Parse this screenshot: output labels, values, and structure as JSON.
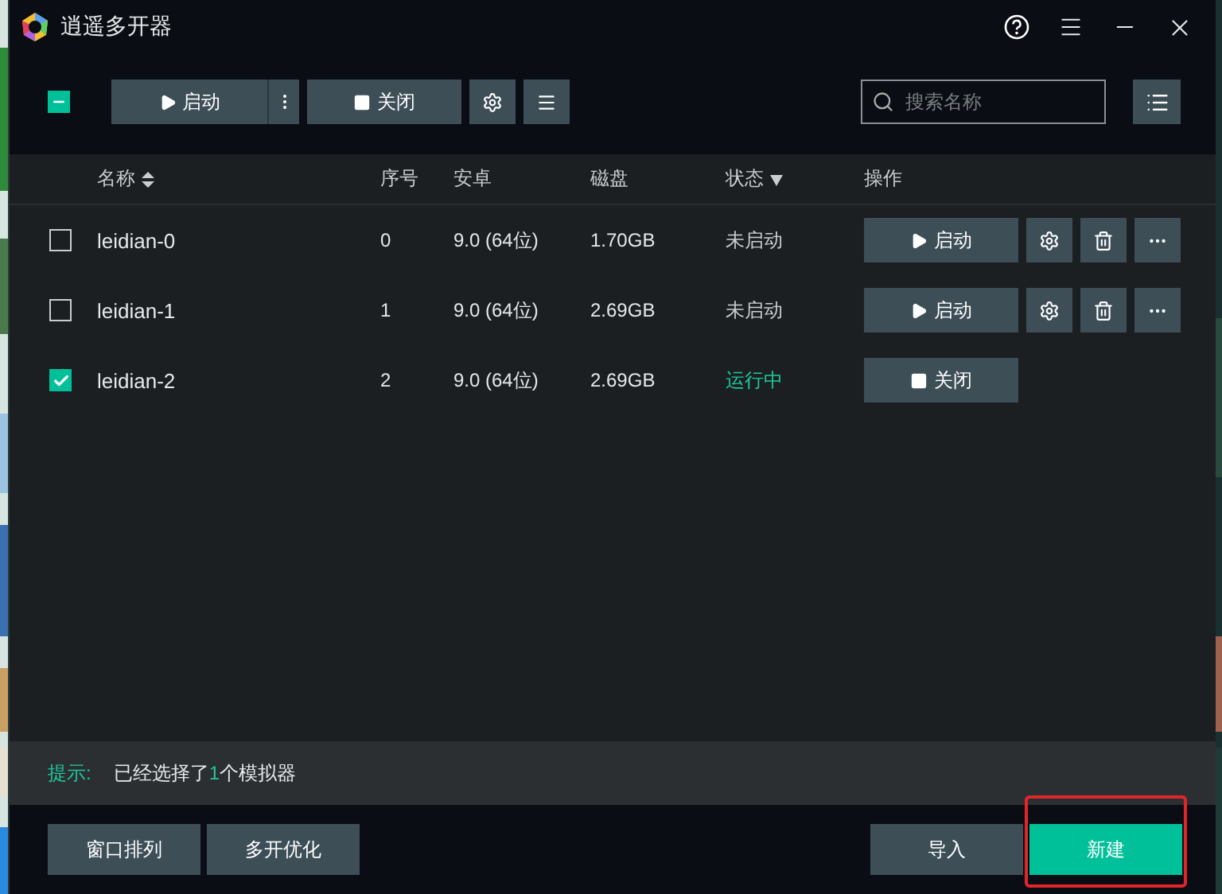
{
  "window": {
    "title": "逍遥多开器"
  },
  "toolbar": {
    "select_all": {
      "indeterminate": true
    },
    "start_button": {
      "label": "启动"
    },
    "stop_button": {
      "label": "关闭"
    },
    "search": {
      "placeholder": "搜索名称"
    }
  },
  "table": {
    "columns": [
      {
        "label": "名称",
        "sortable": true,
        "filterable": false
      },
      {
        "label": "序号",
        "sortable": false,
        "filterable": false
      },
      {
        "label": "安卓",
        "sortable": false,
        "filterable": false
      },
      {
        "label": "磁盘",
        "sortable": false,
        "filterable": false
      },
      {
        "label": "状态",
        "sortable": false,
        "filterable": true
      },
      {
        "label": "操作",
        "sortable": false,
        "filterable": false
      }
    ],
    "rows": [
      {
        "checked": false,
        "name": "leidian-0",
        "index": "0",
        "android": "9.0 (64位)",
        "disk": "1.70GB",
        "status": {
          "kind": "stopped",
          "label": "未启动"
        },
        "actions": [
          {
            "kind": "start",
            "label": "启动"
          },
          {
            "kind": "settings"
          },
          {
            "kind": "delete"
          },
          {
            "kind": "more"
          }
        ]
      },
      {
        "checked": false,
        "name": "leidian-1",
        "index": "1",
        "android": "9.0 (64位)",
        "disk": "2.69GB",
        "status": {
          "kind": "stopped",
          "label": "未启动"
        },
        "actions": [
          {
            "kind": "start",
            "label": "启动"
          },
          {
            "kind": "settings"
          },
          {
            "kind": "delete"
          },
          {
            "kind": "more"
          }
        ]
      },
      {
        "checked": true,
        "name": "leidian-2",
        "index": "2",
        "android": "9.0 (64位)",
        "disk": "2.69GB",
        "status": {
          "kind": "running",
          "label": "运行中"
        },
        "actions": [
          {
            "kind": "stop",
            "label": "关闭"
          }
        ]
      }
    ]
  },
  "hint": {
    "label": "提示:",
    "prefix": "已经选择了",
    "count": "1",
    "suffix": "个模拟器"
  },
  "footer": {
    "left_buttons": [
      {
        "label": "窗口排列"
      },
      {
        "label": "多开优化"
      }
    ],
    "right_buttons": [
      {
        "label": "导入",
        "kind": "secondary",
        "highlighted": false
      },
      {
        "label": "新建",
        "kind": "primary",
        "highlighted": true
      }
    ]
  }
}
